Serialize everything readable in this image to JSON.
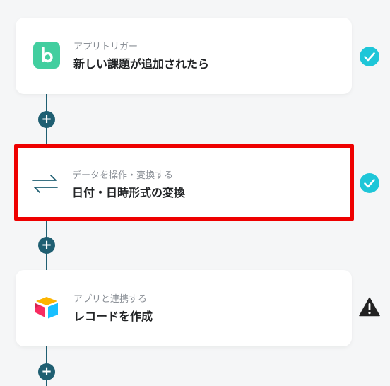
{
  "flow": {
    "steps": [
      {
        "subtitle": "アプリトリガー",
        "title": "新しい課題が追加されたら",
        "icon": "backlog-app-icon",
        "status": "check-done-icon"
      },
      {
        "subtitle": "データを操作・変換する",
        "title": "日付・日時形式の変換",
        "icon": "convert-arrows-icon",
        "status": "check-done-icon",
        "selected": true
      },
      {
        "subtitle": "アプリと連携する",
        "title": "レコードを作成",
        "icon": "airtable-app-icon",
        "status": "warning-icon"
      }
    ],
    "add_step_symbol": "+"
  },
  "colors": {
    "connector": "#1f5f72",
    "check": "#1ec6d8",
    "selected_border": "#ee0000",
    "backlog_green": "#42ce9f",
    "warning": "#222222"
  }
}
